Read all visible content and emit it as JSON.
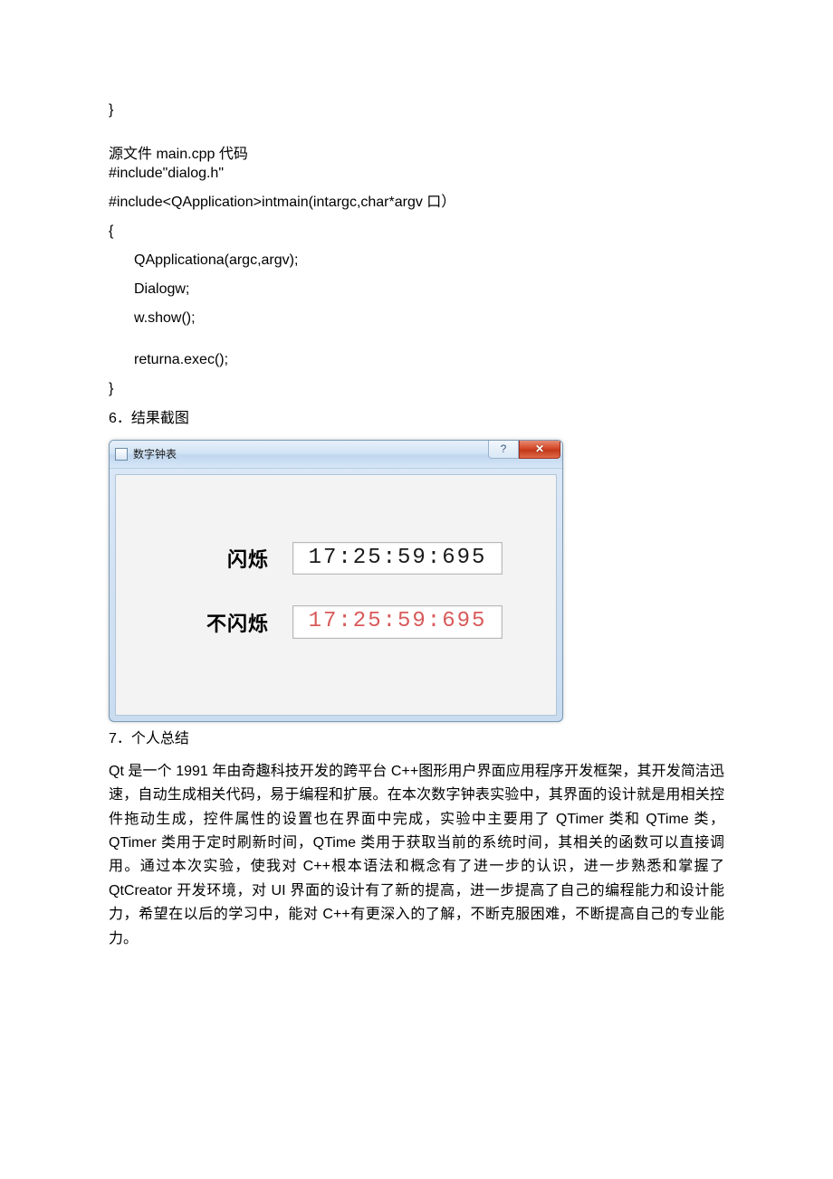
{
  "code_top_brace": "}",
  "source_heading": "源文件 main.cpp 代码",
  "code_line1": "#include\"dialog.h\"",
  "code_line2": "#include<QApplication>intmain(intargc,char*argv 口）",
  "code_line3": "{",
  "code_line4": "QApplicationa(argc,argv);",
  "code_line5": "Dialogw;",
  "code_line6": "w.show();",
  "code_line7": "returna.exec();",
  "code_line8": "}",
  "section6": "6．结果截图",
  "window": {
    "title": "数字钟表",
    "help_symbol": "?",
    "close_symbol": "✕",
    "row1_label": "闪烁",
    "row1_value": "17:25:59:695",
    "row2_label": "不闪烁",
    "row2_value": "17:25:59:695"
  },
  "section7": "7．个人总结",
  "summary": "Qt 是一个 1991 年由奇趣科技开发的跨平台 C++图形用户界面应用程序开发框架，其开发简洁迅速，自动生成相关代码，易于编程和扩展。在本次数字钟表实验中，其界面的设计就是用相关控件拖动生成，控件属性的设置也在界面中完成，实验中主要用了 QTimer 类和 QTime 类，QTimer 类用于定时刷新时间，QTime 类用于获取当前的系统时间，其相关的函数可以直接调用。通过本次实验，使我对 C++根本语法和概念有了进一步的认识，进一步熟悉和掌握了 QtCreator 开发环境，对 UI 界面的设计有了新的提高，进一步提高了自己的编程能力和设计能力，希望在以后的学习中，能对 C++有更深入的了解，不断克服困难，不断提高自己的专业能力。"
}
